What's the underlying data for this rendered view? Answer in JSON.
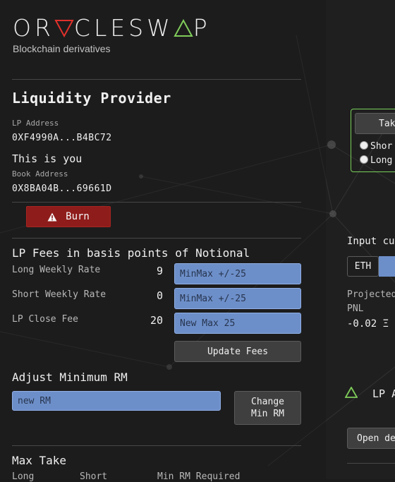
{
  "brand": {
    "logo_prefix": "OR",
    "logo_middle": "CLESW",
    "logo_suffix": "P",
    "tagline": "Blockchain derivatives"
  },
  "lp": {
    "title": "Liquidity Provider",
    "address_label": "LP Address",
    "address": "0XF4990A...B4BC72",
    "you_text": "This is you",
    "book_label": "Book Address",
    "book_address": "0X8BA04B...69661D",
    "burn_label": "Burn"
  },
  "fees": {
    "title": "LP Fees in basis points of Notional",
    "rows": [
      {
        "label": "Long Weekly Rate",
        "value": "9",
        "placeholder": "MinMax +/-25"
      },
      {
        "label": "Short Weekly Rate",
        "value": "0",
        "placeholder": "MinMax +/-25"
      },
      {
        "label": "LP Close Fee",
        "value": "20",
        "placeholder": "New Max 25"
      }
    ],
    "update_label": "Update Fees"
  },
  "min_rm": {
    "title": "Adjust Minimum RM",
    "placeholder": "new RM",
    "button_line1": "Change",
    "button_line2": "Min RM"
  },
  "max_take": {
    "title": "Max Take",
    "col_long": "Long",
    "col_short": "Short",
    "col_min_rm": "Min RM Required"
  },
  "right": {
    "take_label": "Tak",
    "short_label": "Shor",
    "long_label": "Long",
    "input_label": "Input cu",
    "currency": "ETH",
    "projected_label": "Projected",
    "pnl_label": "PNL",
    "pnl_value": "-0.02",
    "pnl_suffix": "Ξ",
    "lp_label": "LP A",
    "open_label": "Open de"
  },
  "colors": {
    "accent_red": "#e0312c",
    "accent_green": "#7fcc5a",
    "input_blue": "#6d8fc9",
    "burn_red": "#8e1c1a"
  }
}
